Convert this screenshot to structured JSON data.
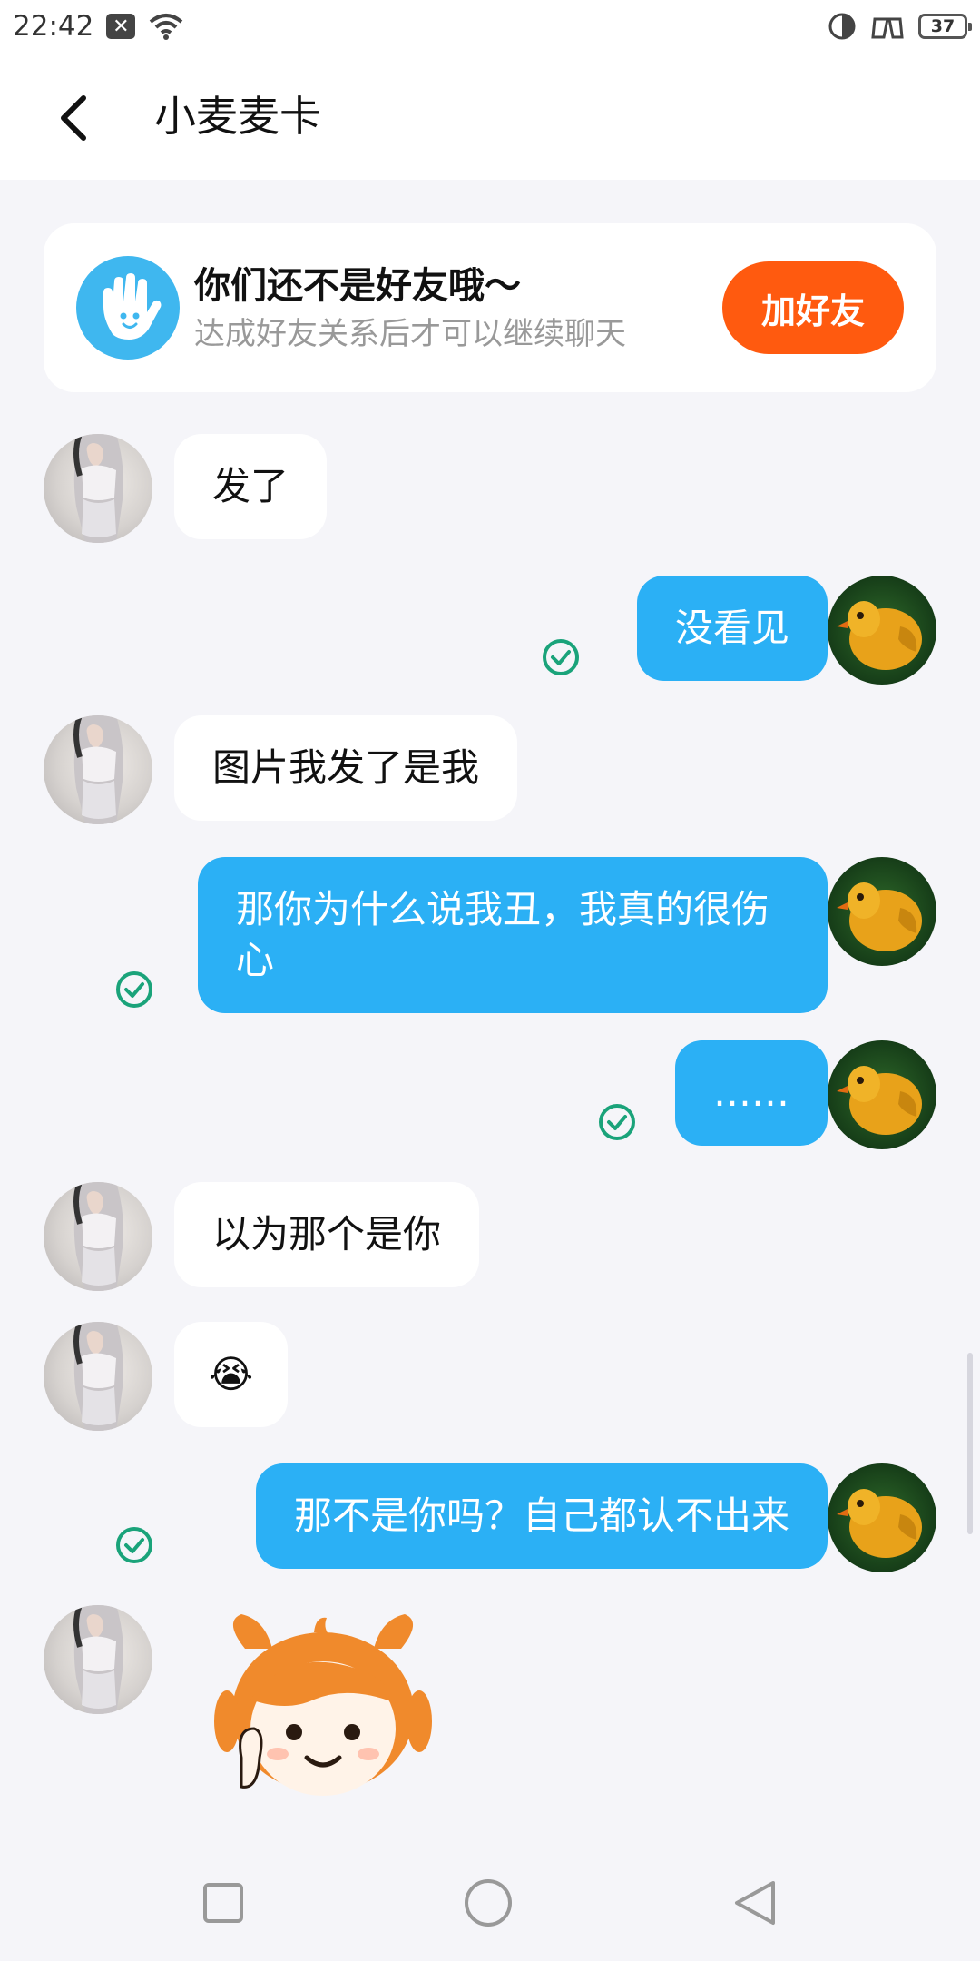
{
  "status_bar": {
    "time": "22:42",
    "notification_icon": "close-box-icon",
    "wifi_icon": "wifi-icon",
    "right_icons": [
      "data-saver-icon",
      "game-mode-icon"
    ],
    "battery": "37"
  },
  "header": {
    "title": "小麦麦卡",
    "back_icon": "back-arrow-icon"
  },
  "friend_notice": {
    "icon": "waving-hand-icon",
    "title": "你们还不是好友哦～",
    "subtitle": "达成好友关系后才可以继续聊天",
    "button_label": "加好友",
    "button_color": "#ff5a0f"
  },
  "messages": [
    {
      "side": "in",
      "text": "发了"
    },
    {
      "side": "out",
      "text": "没看见",
      "read": true
    },
    {
      "side": "in",
      "text": "图片我发了是我"
    },
    {
      "side": "out",
      "text": "那你为什么说我丑，我真的很伤心",
      "read": true
    },
    {
      "side": "out",
      "text": "……",
      "read": true
    },
    {
      "side": "in",
      "text": "以为那个是你"
    },
    {
      "side": "in",
      "text": "😭"
    },
    {
      "side": "out",
      "text": "那不是你吗？自己都认不出来",
      "read": true
    },
    {
      "side": "in",
      "sticker": "cartoon-girl-sticker"
    }
  ],
  "colors": {
    "out_bubble": "#2bb0f5",
    "in_bubble": "#ffffff",
    "background": "#f5f5f9",
    "read_check": "#1aa37a"
  },
  "system_nav": [
    "recent-apps-icon",
    "home-icon",
    "back-triangle-icon"
  ]
}
